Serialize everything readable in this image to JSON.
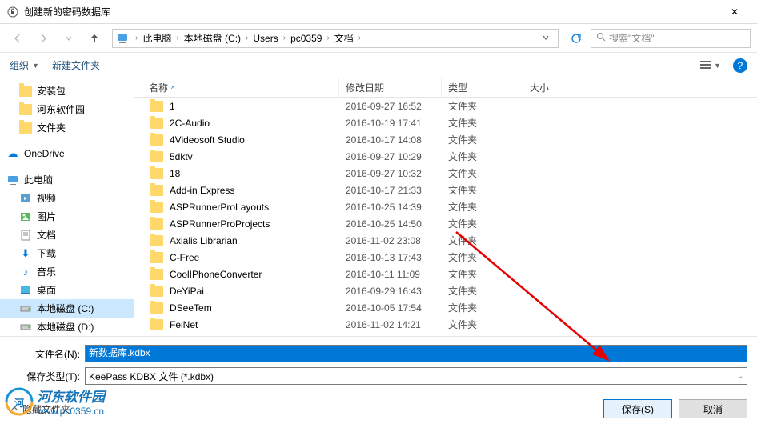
{
  "window": {
    "title": "创建新的密码数据库",
    "close": "✕"
  },
  "nav": {
    "breadcrumb": [
      "此电脑",
      "本地磁盘 (C:)",
      "Users",
      "pc0359",
      "文档"
    ],
    "search_placeholder": "搜索\"文档\""
  },
  "toolbar": {
    "organize": "组织",
    "new_folder": "新建文件夹",
    "help": "?"
  },
  "columns": {
    "name": "名称",
    "date": "修改日期",
    "type": "类型",
    "size": "大小"
  },
  "sidebar": [
    {
      "icon": "folder",
      "label": "安装包",
      "level": 1
    },
    {
      "icon": "folder",
      "label": "河东软件园",
      "level": 1
    },
    {
      "icon": "folder",
      "label": "文件夹",
      "level": 1
    },
    {
      "icon": "onedrive",
      "label": "OneDrive",
      "level": 0
    },
    {
      "icon": "pc",
      "label": "此电脑",
      "level": 0
    },
    {
      "icon": "video",
      "label": "视频",
      "level": 1
    },
    {
      "icon": "pic",
      "label": "图片",
      "level": 1
    },
    {
      "icon": "doc",
      "label": "文档",
      "level": 1
    },
    {
      "icon": "download",
      "label": "下载",
      "level": 1
    },
    {
      "icon": "music",
      "label": "音乐",
      "level": 1
    },
    {
      "icon": "desktop",
      "label": "桌面",
      "level": 1
    },
    {
      "icon": "disk",
      "label": "本地磁盘 (C:)",
      "level": 1,
      "selected": true
    },
    {
      "icon": "disk",
      "label": "本地磁盘 (D:)",
      "level": 1
    }
  ],
  "files": [
    {
      "name": "1",
      "date": "2016-09-27 16:52",
      "type": "文件夹"
    },
    {
      "name": "2C-Audio",
      "date": "2016-10-19 17:41",
      "type": "文件夹"
    },
    {
      "name": "4Videosoft Studio",
      "date": "2016-10-17 14:08",
      "type": "文件夹"
    },
    {
      "name": "5dktv",
      "date": "2016-09-27 10:29",
      "type": "文件夹"
    },
    {
      "name": "18",
      "date": "2016-09-27 10:32",
      "type": "文件夹"
    },
    {
      "name": "Add-in Express",
      "date": "2016-10-17 21:33",
      "type": "文件夹"
    },
    {
      "name": "ASPRunnerProLayouts",
      "date": "2016-10-25 14:39",
      "type": "文件夹"
    },
    {
      "name": "ASPRunnerProProjects",
      "date": "2016-10-25 14:50",
      "type": "文件夹"
    },
    {
      "name": "Axialis Librarian",
      "date": "2016-11-02 23:08",
      "type": "文件夹"
    },
    {
      "name": "C-Free",
      "date": "2016-10-13 17:43",
      "type": "文件夹"
    },
    {
      "name": "CoolIPhoneConverter",
      "date": "2016-10-11 11:09",
      "type": "文件夹"
    },
    {
      "name": "DeYiPai",
      "date": "2016-09-29 16:43",
      "type": "文件夹"
    },
    {
      "name": "DSeeTem",
      "date": "2016-10-05 17:54",
      "type": "文件夹"
    },
    {
      "name": "FeiNet",
      "date": "2016-11-02 14:21",
      "type": "文件夹"
    }
  ],
  "form": {
    "filename_label": "文件名(N):",
    "filename_value": "新数据库.kdbx",
    "filetype_label": "保存类型(T):",
    "filetype_value": "KeePass KDBX 文件 (*.kdbx)"
  },
  "footer": {
    "hide_folders": "隐藏文件夹",
    "save": "保存(S)",
    "cancel": "取消"
  },
  "watermark": {
    "title": "河东软件园",
    "url": "www.pc0359.cn"
  }
}
